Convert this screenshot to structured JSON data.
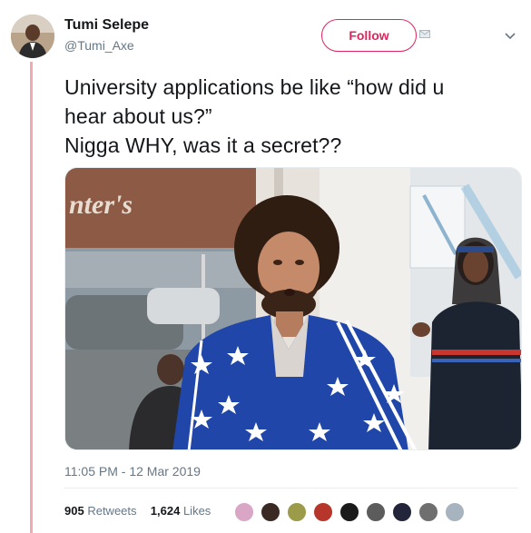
{
  "user": {
    "name": "Tumi Selepe",
    "handle": "@Tumi_Axe"
  },
  "actions": {
    "follow_label": "Follow"
  },
  "tweet": {
    "lines": [
      "University applications be like “how did u",
      "hear about us?”",
      "Nigga WHY, was it a secret??"
    ],
    "image_sign_text": "nter's",
    "timestamp": "11:05 PM - 12 Mar 2019"
  },
  "stats": {
    "retweets_count": "905",
    "retweets_label": "Retweets",
    "likes_count": "1,624",
    "likes_label": "Likes"
  },
  "colors": {
    "accent": "#e0245e",
    "thread_line": "#f2a9b1",
    "secondary_text": "#657786",
    "divider": "#e6ecf0"
  },
  "icons": [
    "mail-icon",
    "chevron-down-icon"
  ]
}
